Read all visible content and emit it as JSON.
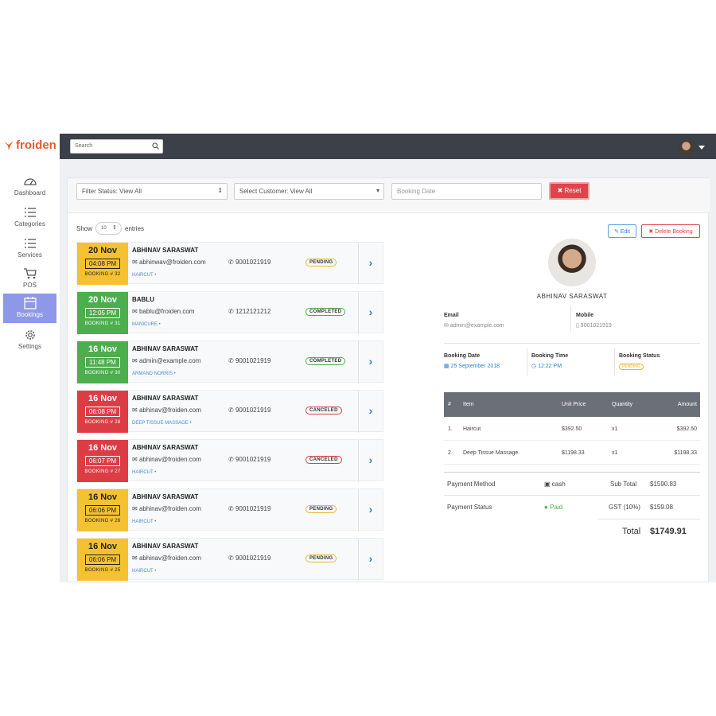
{
  "brand": {
    "name": "froiden"
  },
  "sidebar": {
    "items": [
      {
        "label": "Dashboard",
        "icon": "dashboard-icon"
      },
      {
        "label": "Categories",
        "icon": "list-icon"
      },
      {
        "label": "Services",
        "icon": "list-icon"
      },
      {
        "label": "POS",
        "icon": "cart-icon"
      },
      {
        "label": "Bookings",
        "icon": "calendar-icon",
        "active": true
      },
      {
        "label": "Settings",
        "icon": "gear-icon"
      }
    ]
  },
  "topbar": {
    "search_placeholder": "Search"
  },
  "filters": {
    "status": "Filter Status: View All",
    "customer": "Select Customer: View All",
    "date_placeholder": "Booking Date",
    "reset_label": "Reset"
  },
  "list": {
    "show_label": "Show",
    "entries_value": "10",
    "entries_label": "entries"
  },
  "bookings": [
    {
      "date": "20 Nov",
      "time": "04:08 PM",
      "number": "BOOKING # 32",
      "name": "ABHINAV SARASWAT",
      "email": "abhinwav@froiden.com",
      "phone": "9001021919",
      "service": "HAIRCUT •",
      "status": "PENDING",
      "color": "yel"
    },
    {
      "date": "20 Nov",
      "time": "12:05 PM",
      "number": "BOOKING # 31",
      "name": "BABLU",
      "email": "bablu@froiden.com",
      "phone": "1212121212",
      "service": "MANICURE •",
      "status": "COMPLETED",
      "color": "grn"
    },
    {
      "date": "16 Nov",
      "time": "11:48 PM",
      "number": "BOOKING # 30",
      "name": "ABHINAV SARASWAT",
      "email": "admin@example.com",
      "phone": "9001021919",
      "service": "ARMAND NORRIS •",
      "status": "COMPLETED",
      "color": "grn"
    },
    {
      "date": "16 Nov",
      "time": "06:08 PM",
      "number": "BOOKING # 28",
      "name": "ABHINAV SARASWAT",
      "email": "abhinav@froiden.com",
      "phone": "9001021919",
      "service": "DEEP TISSUE MASSAGE •",
      "status": "CANCELED",
      "color": "red"
    },
    {
      "date": "16 Nov",
      "time": "06:07 PM",
      "number": "BOOKING # 27",
      "name": "ABHINAV SARASWAT",
      "email": "abhinav@froiden.com",
      "phone": "9001021919",
      "service": "HAIRCUT •",
      "status": "CANCELED",
      "color": "red"
    },
    {
      "date": "16 Nov",
      "time": "06:06 PM",
      "number": "BOOKING # 26",
      "name": "ABHINAV SARASWAT",
      "email": "abhinav@froiden.com",
      "phone": "9001021919",
      "service": "HAIRCUT •",
      "status": "PENDING",
      "color": "yel"
    },
    {
      "date": "16 Nov",
      "time": "06:06 PM",
      "number": "BOOKING # 25",
      "name": "ABHINAV SARASWAT",
      "email": "abhinav@froiden.com",
      "phone": "9001021919",
      "service": "HAIRCUT •",
      "status": "PENDING",
      "color": "yel"
    }
  ],
  "detail": {
    "edit_label": "Edit",
    "delete_label": "Delete Booking",
    "customer_name": "ABHINAV SARASWAT",
    "email_label": "Email",
    "email": "admin@example.com",
    "mobile_label": "Mobile",
    "mobile": "9001021919",
    "date_label": "Booking Date",
    "date": "25 September 2018",
    "time_label": "Booking Time",
    "time": "12:22 PM",
    "status_label": "Booking Status",
    "status": "PENDING",
    "table": {
      "headers": [
        "#",
        "Item",
        "Unit Price",
        "Quantity",
        "Amount"
      ],
      "rows": [
        {
          "n": "1.",
          "item": "Haircut",
          "price": "$392.50",
          "qty": "x1",
          "amount": "$392.50"
        },
        {
          "n": "2.",
          "item": "Deep Tissue Massage",
          "price": "$1198.33",
          "qty": "x1",
          "amount": "$1198.33"
        }
      ]
    },
    "payment_method_label": "Payment Method",
    "payment_method": "cash",
    "payment_status_label": "Payment Status",
    "payment_status": "Paid",
    "subtotal_label": "Sub Total",
    "subtotal": "$1590.83",
    "gst_label": "GST (10%)",
    "gst": "$159.08",
    "total_label": "Total",
    "total": "$1749.91"
  }
}
